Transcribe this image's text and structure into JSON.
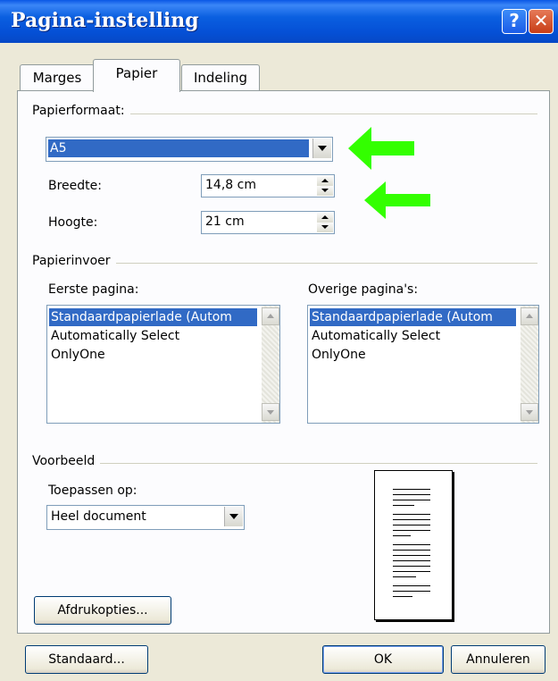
{
  "window": {
    "title": "Pagina-instelling",
    "help_glyph": "?",
    "close_glyph": "✕"
  },
  "tabs": [
    {
      "label": "Marges",
      "active": false
    },
    {
      "label": "Papier",
      "active": true
    },
    {
      "label": "Indeling",
      "active": false
    }
  ],
  "paper_size": {
    "group_label": "Papierformaat:",
    "selected": "A5",
    "width_label": "Breedte:",
    "width_value": "14,8 cm",
    "height_label": "Hoogte:",
    "height_value": "21 cm"
  },
  "paper_source": {
    "group_label": "Papierinvoer",
    "first_page_label": "Eerste pagina:",
    "other_pages_label": "Overige pagina's:",
    "first_page_items": [
      "Standaardpapierlade (Autom",
      "Automatically Select",
      "OnlyOne"
    ],
    "other_pages_items": [
      "Standaardpapierlade (Autom",
      "Automatically Select",
      "OnlyOne"
    ],
    "selected_index": 0
  },
  "preview": {
    "group_label": "Voorbeeld",
    "apply_to_label": "Toepassen op:",
    "apply_to_value": "Heel document"
  },
  "buttons": {
    "print_options": "Afdrukopties...",
    "default": "Standaard...",
    "ok": "OK",
    "cancel": "Annuleren"
  },
  "colors": {
    "annotation_arrow": "#33ff00",
    "selection": "#316ac5",
    "titlebar": "#0a5fe0"
  }
}
